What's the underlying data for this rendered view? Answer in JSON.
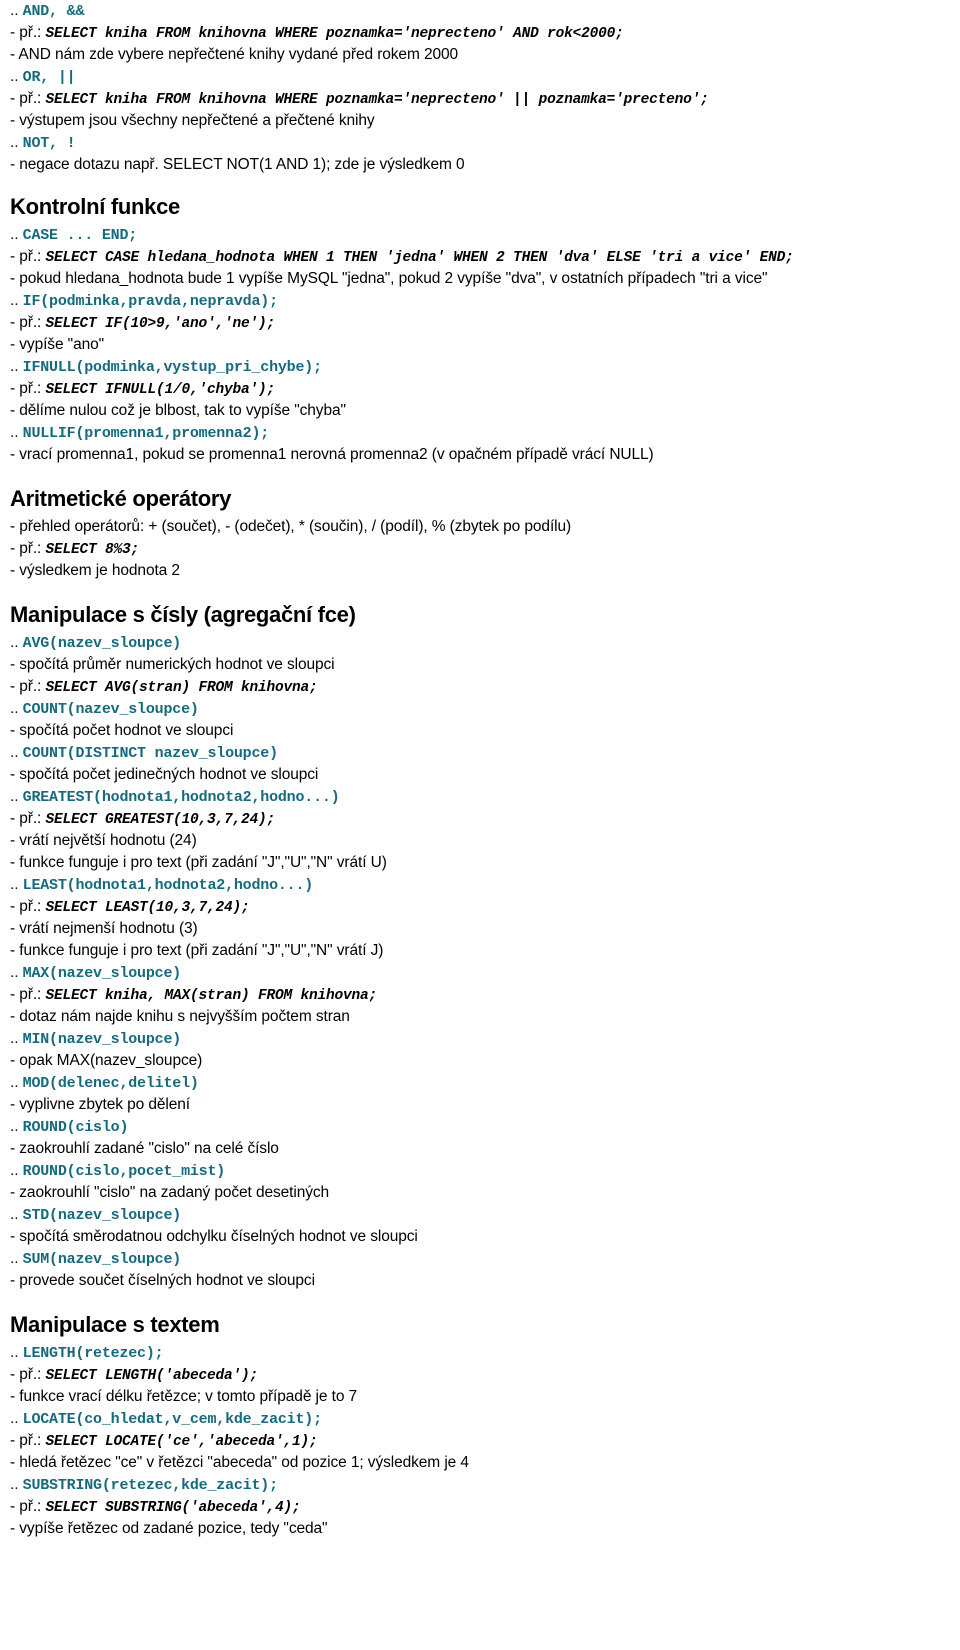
{
  "document": {
    "language": "cs",
    "colors": {
      "code_teal": "#176a7d",
      "text_black": "#000000",
      "background": "#ffffff"
    },
    "blocks": [
      {
        "type": "sig",
        "dots": "..",
        "code": "AND, &&"
      },
      {
        "type": "ex",
        "label": "- př.:",
        "code": "SELECT kniha FROM knihovna WHERE poznamka='neprecteno' AND rok<2000;"
      },
      {
        "type": "desc",
        "text": "- AND nám zde vybere nepřečtené knihy vydané před rokem 2000"
      },
      {
        "type": "sig",
        "dots": "..",
        "code": "OR, ||"
      },
      {
        "type": "ex",
        "label": "- př.:",
        "code": "SELECT kniha FROM knihovna WHERE poznamka='neprecteno' || poznamka='precteno';"
      },
      {
        "type": "desc",
        "text": "- výstupem jsou všechny nepřečtené a přečtené knihy"
      },
      {
        "type": "sig",
        "dots": "..",
        "code": "NOT, !"
      },
      {
        "type": "desc",
        "text": "- negace dotazu např. SELECT NOT(1 AND 1); zde je výsledkem 0"
      },
      {
        "type": "heading",
        "text": "Kontrolní funkce"
      },
      {
        "type": "sig",
        "dots": "..",
        "code": "CASE ... END;"
      },
      {
        "type": "ex",
        "label": "- př.:",
        "code": "SELECT CASE hledana_hodnota WHEN 1 THEN 'jedna' WHEN 2 THEN 'dva' ELSE 'tri a vice' END;"
      },
      {
        "type": "desc",
        "text": "- pokud hledana_hodnota bude 1 vypíše MySQL \"jedna\", pokud 2 vypíše \"dva\", v ostatních případech \"tri a vice\""
      },
      {
        "type": "sig",
        "dots": "..",
        "code": "IF(podminka,pravda,nepravda);"
      },
      {
        "type": "ex",
        "label": "- př.:",
        "code": "SELECT IF(10>9,'ano','ne');"
      },
      {
        "type": "desc",
        "text": "- vypíše \"ano\""
      },
      {
        "type": "sig",
        "dots": "..",
        "code": "IFNULL(podminka,vystup_pri_chybe);"
      },
      {
        "type": "ex",
        "label": "- př.:",
        "code": "SELECT IFNULL(1/0,'chyba');"
      },
      {
        "type": "desc",
        "text": "- dělíme nulou což je blbost, tak to vypíše \"chyba\""
      },
      {
        "type": "sig",
        "dots": "..",
        "code": "NULLIF(promenna1,promenna2);"
      },
      {
        "type": "desc",
        "text": "- vrací promenna1, pokud se promenna1 nerovná promenna2 (v opačném případě vrácí NULL)"
      },
      {
        "type": "heading",
        "text": "Aritmetické operátory"
      },
      {
        "type": "desc",
        "text": "- přehled operátorů: + (součet), - (odečet), * (součin), / (podíl), % (zbytek po podílu)"
      },
      {
        "type": "ex",
        "label": "- př.:",
        "code": "SELECT 8%3;"
      },
      {
        "type": "desc",
        "text": "- výsledkem je hodnota 2"
      },
      {
        "type": "heading",
        "text": "Manipulace s čísly (agregační fce)"
      },
      {
        "type": "sig",
        "dots": "..",
        "code": "AVG(nazev_sloupce)"
      },
      {
        "type": "desc",
        "text": "- spočítá průměr numerických hodnot ve sloupci"
      },
      {
        "type": "ex",
        "label": "- př.:",
        "code": "SELECT AVG(stran) FROM knihovna;"
      },
      {
        "type": "sig",
        "dots": "..",
        "code": "COUNT(nazev_sloupce)"
      },
      {
        "type": "desc",
        "text": "- spočítá počet hodnot ve sloupci"
      },
      {
        "type": "sig",
        "dots": "..",
        "code": "COUNT(DISTINCT nazev_sloupce)"
      },
      {
        "type": "desc",
        "text": "- spočítá počet jedinečných hodnot ve sloupci"
      },
      {
        "type": "sig",
        "dots": "..",
        "code": "GREATEST(hodnota1,hodnota2,hodno...)"
      },
      {
        "type": "ex",
        "label": "- př.:",
        "code": "SELECT GREATEST(10,3,7,24);"
      },
      {
        "type": "desc",
        "text": "- vrátí největší hodnotu (24)"
      },
      {
        "type": "desc",
        "text": "- funkce funguje i pro text (při zadání \"J\",\"U\",\"N\" vrátí U)"
      },
      {
        "type": "sig",
        "dots": "..",
        "code": "LEAST(hodnota1,hodnota2,hodno...)"
      },
      {
        "type": "ex",
        "label": "- př.:",
        "code": "SELECT LEAST(10,3,7,24);"
      },
      {
        "type": "desc",
        "text": "- vrátí nejmenší hodnotu (3)"
      },
      {
        "type": "desc",
        "text": "- funkce funguje i pro text (při zadání \"J\",\"U\",\"N\" vrátí J)"
      },
      {
        "type": "sig",
        "dots": "..",
        "code": "MAX(nazev_sloupce)"
      },
      {
        "type": "ex",
        "label": "- př.:",
        "code": "SELECT kniha, MAX(stran) FROM knihovna;"
      },
      {
        "type": "desc",
        "text": "- dotaz nám najde knihu s nejvyšším počtem stran"
      },
      {
        "type": "sig",
        "dots": "..",
        "code": "MIN(nazev_sloupce)"
      },
      {
        "type": "desc",
        "text": "- opak MAX(nazev_sloupce)"
      },
      {
        "type": "sig",
        "dots": "..",
        "code": "MOD(delenec,delitel)"
      },
      {
        "type": "desc",
        "text": "- vyplivne zbytek po dělení"
      },
      {
        "type": "sig",
        "dots": "..",
        "code": "ROUND(cislo)"
      },
      {
        "type": "desc",
        "text": "- zaokrouhlí zadané \"cislo\" na celé číslo"
      },
      {
        "type": "sig",
        "dots": "..",
        "code": "ROUND(cislo,pocet_mist)"
      },
      {
        "type": "desc",
        "text": "- zaokrouhlí \"cislo\" na zadaný počet desetiných"
      },
      {
        "type": "sig",
        "dots": "..",
        "code": "STD(nazev_sloupce)"
      },
      {
        "type": "desc",
        "text": "- spočítá směrodatnou odchylku číselných hodnot ve sloupci"
      },
      {
        "type": "sig",
        "dots": "..",
        "code": "SUM(nazev_sloupce)"
      },
      {
        "type": "desc",
        "text": "- provede součet číselných hodnot ve sloupci"
      },
      {
        "type": "heading",
        "text": "Manipulace s textem"
      },
      {
        "type": "sig",
        "dots": "..",
        "code": "LENGTH(retezec);"
      },
      {
        "type": "ex",
        "label": "- př.:",
        "code": "SELECT LENGTH('abeceda');"
      },
      {
        "type": "desc",
        "text": "- funkce vrací délku řetězce; v tomto případě je to 7"
      },
      {
        "type": "sig",
        "dots": "..",
        "code": "LOCATE(co_hledat,v_cem,kde_zacit);"
      },
      {
        "type": "ex",
        "label": "- př.:",
        "code": "SELECT LOCATE('ce','abeceda',1);"
      },
      {
        "type": "desc",
        "text": "- hledá řetězec \"ce\" v řetězci \"abeceda\" od pozice 1; výsledkem je 4"
      },
      {
        "type": "sig",
        "dots": "..",
        "code": "SUBSTRING(retezec,kde_zacit);"
      },
      {
        "type": "ex",
        "label": "- př.:",
        "code": "SELECT SUBSTRING('abeceda',4);"
      },
      {
        "type": "desc",
        "text": "- vypíše řetězec od zadané pozice, tedy \"ceda\""
      }
    ]
  }
}
